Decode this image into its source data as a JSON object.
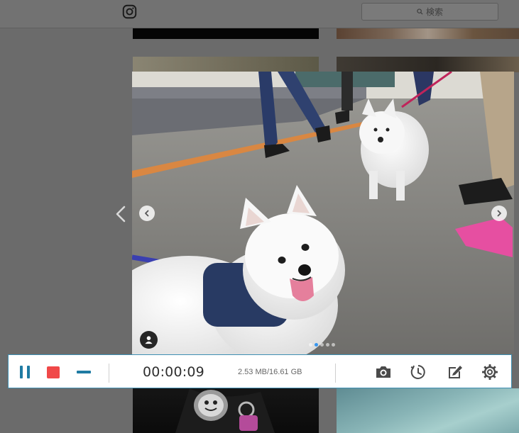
{
  "header": {
    "search_placeholder": "検索"
  },
  "recorder": {
    "elapsed_time": "00:00:09",
    "file_size": "2.53 MB/16.61 GB"
  },
  "carousel": {
    "slide_count": 5,
    "active_slide": 2
  },
  "colors": {
    "toolbar_accent": "#1f7ba3",
    "stop_red": "#f04848",
    "toolbar_border": "#3e8fb3",
    "carousel_active_dot": "#3897f0"
  },
  "icons": {
    "logo": "instagram-icon",
    "search": "search-icon",
    "pause": "pause-icon",
    "stop": "stop-icon",
    "minimize": "minimize-icon",
    "screenshot": "camera-icon",
    "schedule": "clock-icon",
    "annotate": "edit-icon",
    "settings": "gear-icon",
    "prev": "chevron-left-icon",
    "next": "chevron-right-icon",
    "tagged_user": "user-icon"
  }
}
